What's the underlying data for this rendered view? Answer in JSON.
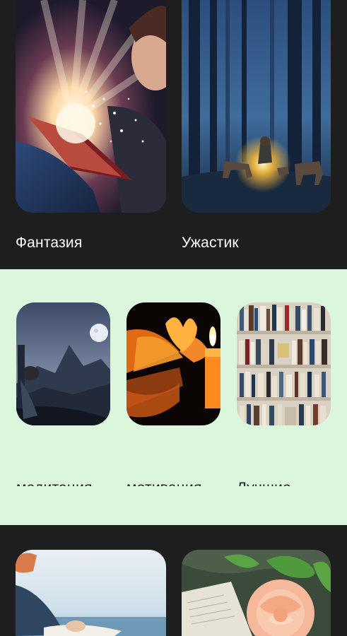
{
  "sections": [
    {
      "theme": "dark",
      "background": "#1e1e1f",
      "items": [
        {
          "label": "Фантазия",
          "image": "boy-reading-glowing-book"
        },
        {
          "label": "Ужастик",
          "image": "night-forest-lantern-foxes"
        }
      ]
    },
    {
      "theme": "light",
      "background": "#dcf5dd",
      "items": [
        {
          "label": "медитация",
          "image": "meditating-woman-moon-mountains"
        },
        {
          "label": "мотивация",
          "image": "heart-book-candle"
        },
        {
          "label": "Лучшие книги",
          "image": "bookshelf"
        }
      ]
    },
    {
      "theme": "dark",
      "background": "#1e1e1f",
      "items": [
        {
          "label": "",
          "image": "woman-by-sea-reading"
        },
        {
          "label": "",
          "image": "rose-on-book"
        }
      ]
    }
  ]
}
